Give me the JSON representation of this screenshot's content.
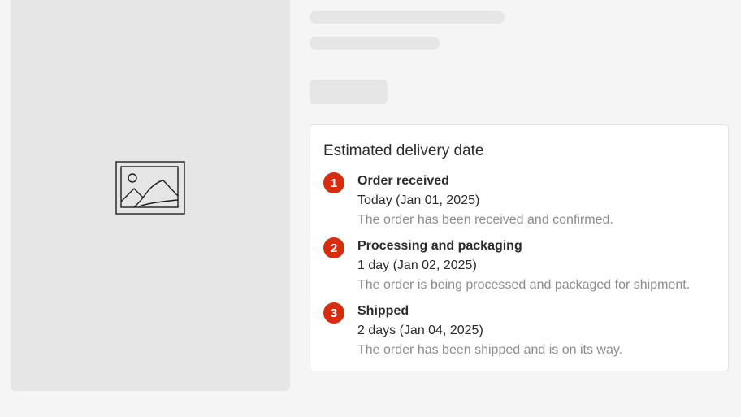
{
  "colors": {
    "badge": "#d72c0d",
    "skeleton": "#e6e6e6",
    "muted_text": "#8c8c8c"
  },
  "product_image": {
    "icon": "image-placeholder-icon"
  },
  "delivery": {
    "title": "Estimated delivery date",
    "steps": [
      {
        "number": "1",
        "title": "Order received",
        "when": "Today (Jan 01, 2025)",
        "description": "The order has been received and confirmed."
      },
      {
        "number": "2",
        "title": "Processing and packaging",
        "when": "1 day (Jan 02, 2025)",
        "description": "The order is being processed and packaged for shipment."
      },
      {
        "number": "3",
        "title": "Shipped",
        "when": "2 days (Jan 04, 2025)",
        "description": "The order has been shipped and is on its way."
      }
    ]
  }
}
